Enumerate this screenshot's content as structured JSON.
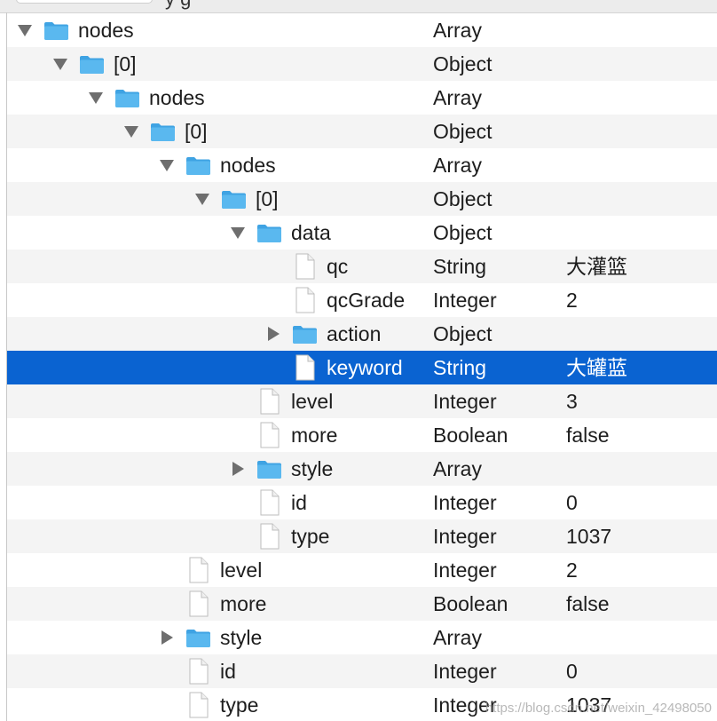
{
  "header": {
    "fragment": "y g"
  },
  "colors": {
    "selection": "#0a63d1",
    "alt_row": "#f4f4f4",
    "folder": "#5ab8ef",
    "text": "#1d1d1d"
  },
  "rows": [
    {
      "key": "nodes",
      "type": "Array",
      "value": "",
      "depth": 0,
      "disclosure": "down",
      "icon": "folder-icon"
    },
    {
      "key": "[0]",
      "type": "Object",
      "value": "",
      "depth": 1,
      "disclosure": "down",
      "icon": "folder-icon"
    },
    {
      "key": "nodes",
      "type": "Array",
      "value": "",
      "depth": 2,
      "disclosure": "down",
      "icon": "folder-icon"
    },
    {
      "key": "[0]",
      "type": "Object",
      "value": "",
      "depth": 3,
      "disclosure": "down",
      "icon": "folder-icon"
    },
    {
      "key": "nodes",
      "type": "Array",
      "value": "",
      "depth": 4,
      "disclosure": "down",
      "icon": "folder-icon"
    },
    {
      "key": "[0]",
      "type": "Object",
      "value": "",
      "depth": 5,
      "disclosure": "down",
      "icon": "folder-icon"
    },
    {
      "key": "data",
      "type": "Object",
      "value": "",
      "depth": 6,
      "disclosure": "down",
      "icon": "folder-icon"
    },
    {
      "key": "qc",
      "type": "String",
      "value": "大灌篮",
      "depth": 7,
      "disclosure": "none",
      "icon": "file-icon"
    },
    {
      "key": "qcGrade",
      "type": "Integer",
      "value": "2",
      "depth": 7,
      "disclosure": "none",
      "icon": "file-icon"
    },
    {
      "key": "action",
      "type": "Object",
      "value": "",
      "depth": 7,
      "disclosure": "right",
      "icon": "folder-icon"
    },
    {
      "key": "keyword",
      "type": "String",
      "value": "大罐蓝",
      "depth": 7,
      "disclosure": "none",
      "icon": "file-icon",
      "selected": true
    },
    {
      "key": "level",
      "type": "Integer",
      "value": "3",
      "depth": 6,
      "disclosure": "none",
      "icon": "file-icon"
    },
    {
      "key": "more",
      "type": "Boolean",
      "value": "false",
      "depth": 6,
      "disclosure": "none",
      "icon": "file-icon"
    },
    {
      "key": "style",
      "type": "Array",
      "value": "",
      "depth": 6,
      "disclosure": "right",
      "icon": "folder-icon"
    },
    {
      "key": "id",
      "type": "Integer",
      "value": "0",
      "depth": 6,
      "disclosure": "none",
      "icon": "file-icon"
    },
    {
      "key": "type",
      "type": "Integer",
      "value": "1037",
      "depth": 6,
      "disclosure": "none",
      "icon": "file-icon"
    },
    {
      "key": "level",
      "type": "Integer",
      "value": "2",
      "depth": 4,
      "disclosure": "none",
      "icon": "file-icon"
    },
    {
      "key": "more",
      "type": "Boolean",
      "value": "false",
      "depth": 4,
      "disclosure": "none",
      "icon": "file-icon"
    },
    {
      "key": "style",
      "type": "Array",
      "value": "",
      "depth": 4,
      "disclosure": "right",
      "icon": "folder-icon"
    },
    {
      "key": "id",
      "type": "Integer",
      "value": "0",
      "depth": 4,
      "disclosure": "none",
      "icon": "file-icon"
    },
    {
      "key": "type",
      "type": "Integer",
      "value": "1037",
      "depth": 4,
      "disclosure": "none",
      "icon": "file-icon"
    }
  ],
  "watermark": "https://blog.csdn.net/weixin_42498050"
}
